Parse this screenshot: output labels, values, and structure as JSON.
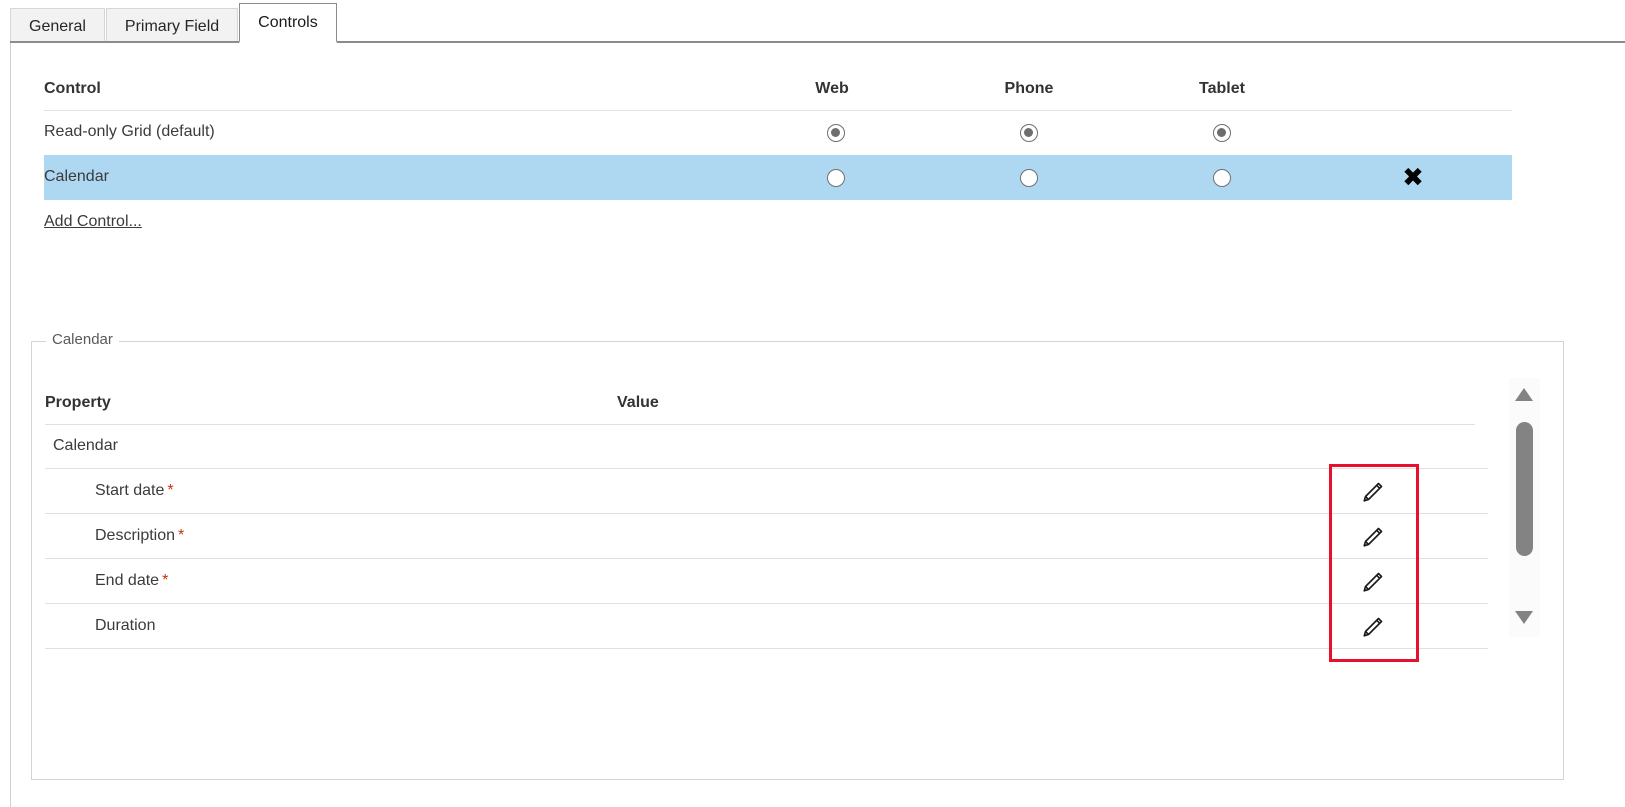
{
  "tabs": [
    {
      "label": "General",
      "active": false
    },
    {
      "label": "Primary Field",
      "active": false
    },
    {
      "label": "Controls",
      "active": true
    }
  ],
  "control_table": {
    "headers": {
      "control": "Control",
      "web": "Web",
      "phone": "Phone",
      "tablet": "Tablet"
    },
    "rows": [
      {
        "label": "Read-only Grid (default)",
        "web_checked": true,
        "phone_checked": true,
        "tablet_checked": true,
        "selected": false,
        "removable": false,
        "remove_label": ""
      },
      {
        "label": "Calendar",
        "web_checked": false,
        "phone_checked": false,
        "tablet_checked": false,
        "selected": true,
        "removable": true,
        "remove_label": "✖"
      }
    ],
    "add_control_label": "Add Control..."
  },
  "properties_panel": {
    "legend": "Calendar",
    "headers": {
      "property": "Property",
      "value": "Value"
    },
    "rows": [
      {
        "name": "Calendar",
        "required": false,
        "indent": 0,
        "has_edit": false,
        "value": ""
      },
      {
        "name": "Start date",
        "required": true,
        "indent": 1,
        "has_edit": true,
        "value": ""
      },
      {
        "name": "Description",
        "required": true,
        "indent": 1,
        "has_edit": true,
        "value": ""
      },
      {
        "name": "End date",
        "required": true,
        "indent": 1,
        "has_edit": true,
        "value": ""
      },
      {
        "name": "Duration",
        "required": false,
        "indent": 1,
        "has_edit": true,
        "value": ""
      }
    ],
    "required_marker": "*"
  },
  "annotation": {
    "highlight_color": "#e8112d"
  },
  "colors": {
    "selected_row": "#aed8f2",
    "required_asterisk": "#c8300d",
    "scrollbar_thumb": "#838383",
    "tab_active_bg": "#ffffff",
    "tab_inactive_bg": "#f2f2f2"
  },
  "scrollbar": {
    "up_arrow": "scroll-up-arrow",
    "down_arrow": "scroll-down-arrow",
    "thumb": "scroll-thumb"
  }
}
